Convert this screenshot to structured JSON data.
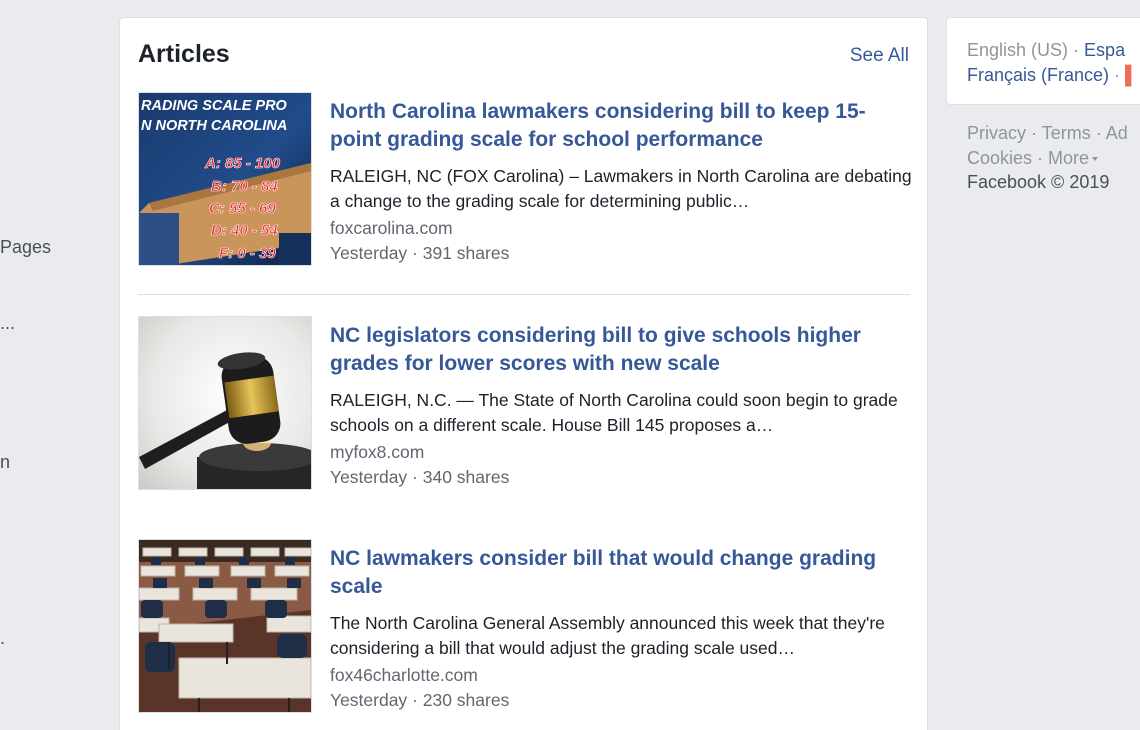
{
  "left_sidebar": {
    "fragments": [
      "Pages",
      "...",
      "n",
      "."
    ]
  },
  "articles_card": {
    "title": "Articles",
    "see_all": "See All",
    "items": [
      {
        "title": "North Carolina lawmakers considering bill to keep 15-point grading scale for school performance",
        "description": "RALEIGH, NC (FOX Carolina) – Lawmakers in North Carolina are debating a change to the grading scale for determining public…",
        "source": "foxcarolina.com",
        "meta": "Yesterday · 391 shares",
        "thumb": {
          "heading_1": "RADING SCALE PRO",
          "heading_2": "N NORTH CAROLINA",
          "grades": [
            "A: 85 - 100",
            "B: 70 - 84",
            "C: 55 - 69",
            "D: 40 - 54",
            "F: 0 - 39"
          ]
        }
      },
      {
        "title": "NC legislators considering bill to give schools higher grades for lower scores with new scale",
        "description": "RALEIGH, N.C. — The State of North Carolina could soon begin to grade schools on a different scale. House Bill 145 proposes a…",
        "source": "myfox8.com",
        "meta": "Yesterday · 340 shares"
      },
      {
        "title": "NC lawmakers consider bill that would change grading scale",
        "description": "The North Carolina General Assembly announced this week that they're considering a bill that would adjust the grading scale used…",
        "source": "fox46charlotte.com",
        "meta": "Yesterday · 230 shares"
      }
    ]
  },
  "languages": {
    "english": "English (US)",
    "espanol": "Espa",
    "francais": "Français (France)",
    "separator": "·"
  },
  "footer": {
    "privacy": "Privacy",
    "terms": "Terms",
    "ad": "Ad",
    "cookies": "Cookies",
    "more": "More",
    "separator": "·",
    "copyright": "Facebook © 2019"
  },
  "colors": {
    "link": "#365899",
    "background": "#e9ebee",
    "secondary_text": "#606770",
    "muted": "#90949c"
  }
}
